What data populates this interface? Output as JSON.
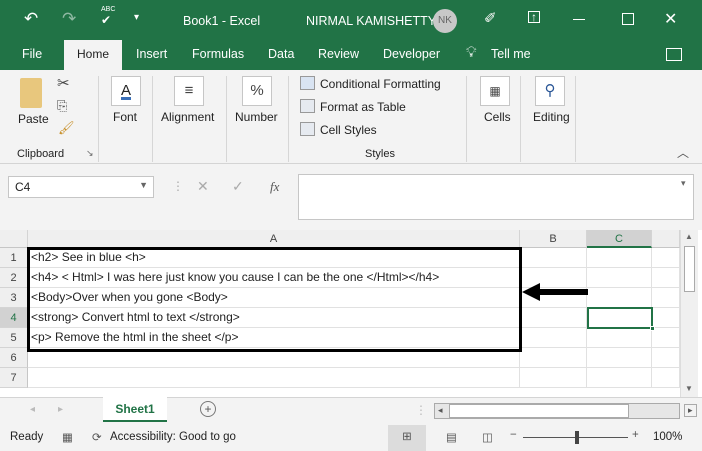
{
  "titlebar": {
    "title": "Book1  -  Excel",
    "user": "NIRMAL KAMISHETTY",
    "initials": "NK",
    "spell": "ABC"
  },
  "tabs": [
    "File",
    "Home",
    "Insert",
    "Formulas",
    "Data",
    "Review",
    "Developer",
    "Tell me"
  ],
  "ribbon": {
    "paste": "Paste",
    "clipboard": "Clipboard",
    "font": "Font",
    "alignment": "Alignment",
    "number": "Number",
    "number_glyph": "%",
    "conditional": "Conditional Formatting",
    "format_table": "Format as Table",
    "cell_styles": "Cell Styles",
    "styles": "Styles",
    "cells": "Cells",
    "editing": "Editing"
  },
  "formula_bar": {
    "name_box": "C4",
    "fx": "fx",
    "value": ""
  },
  "columns": [
    "A",
    "B",
    "C"
  ],
  "rows": [
    {
      "n": "1",
      "a": "<h2> See in blue <h>"
    },
    {
      "n": "2",
      "a": "<h4> < Html> I was here just know you cause I can be the one </Html></h4>"
    },
    {
      "n": "3",
      "a": "<Body>Over when you gone <Body>"
    },
    {
      "n": "4",
      "a": "<strong>  Convert html to text </strong>"
    },
    {
      "n": "5",
      "a": "<p> Remove the html in the sheet </p>"
    },
    {
      "n": "6",
      "a": ""
    },
    {
      "n": "7",
      "a": ""
    }
  ],
  "sheets": {
    "active": "Sheet1"
  },
  "status": {
    "ready": "Ready",
    "accessibility": "Accessibility: Good to go",
    "zoom": "100%"
  },
  "colors": {
    "accent": "#217346"
  }
}
